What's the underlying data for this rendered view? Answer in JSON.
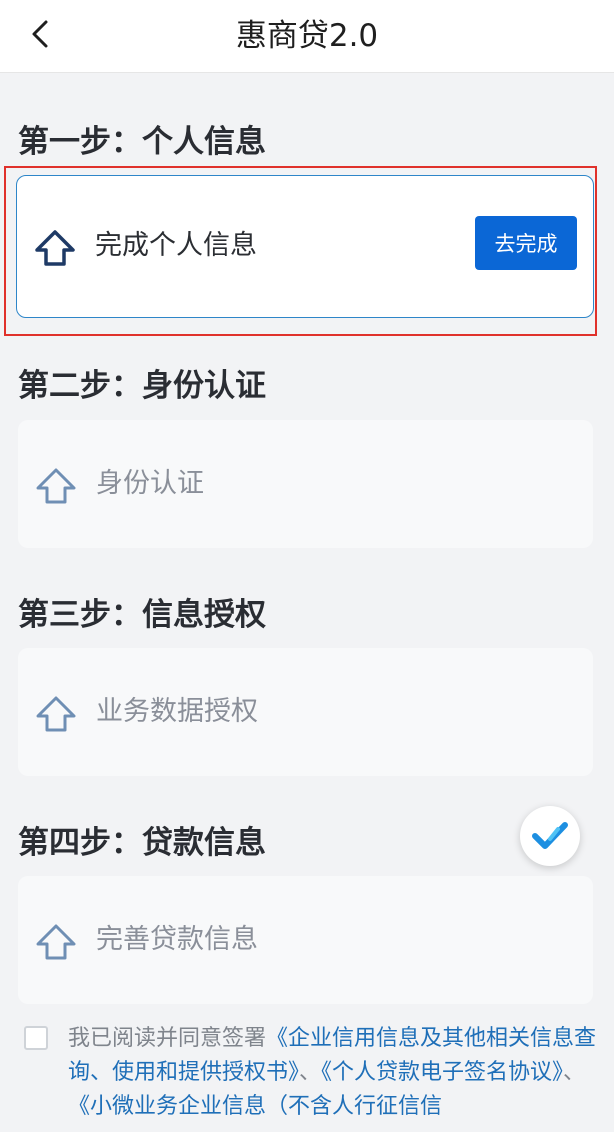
{
  "header": {
    "title": "惠商贷2.0"
  },
  "steps": [
    {
      "title": "第一步：个人信息",
      "card_label": "完成个人信息",
      "button_label": "去完成"
    },
    {
      "title": "第二步：身份认证",
      "card_label": "身份认证"
    },
    {
      "title": "第三步：信息授权",
      "card_label": "业务数据授权"
    },
    {
      "title": "第四步：贷款信息",
      "card_label": "完善贷款信息"
    }
  ],
  "agreement": {
    "prefix": "我已阅读并同意签署",
    "link1": "《企业信用信息及其他相关信息查询、使用和提供授权书》",
    "sep": "、",
    "link2": "《个人贷款电子签名协议》",
    "link3": "《小微业务企业信息（不含人行征信信"
  },
  "colors": {
    "accent": "#0b67d6",
    "highlight_border": "#e0312b",
    "link": "#1f6fb8"
  },
  "icons": {
    "back": "chevron-left-icon",
    "step": "up-arrow-icon",
    "float": "check-icon"
  }
}
